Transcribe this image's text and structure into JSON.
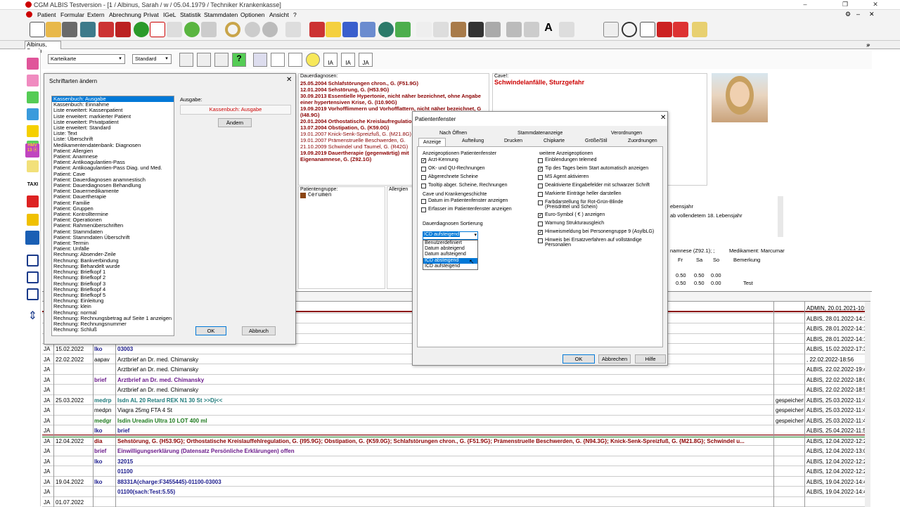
{
  "window": {
    "title": "CGM ALBIS Testversion - [1 / Albinus, Sarah / w / 05.04.1979 / Techniker Krankenkasse]"
  },
  "menu": [
    "Patient",
    "Formular",
    "Extern",
    "Abrechnung",
    "Privat",
    "IGeL",
    "Statistik",
    "Stammdaten",
    "Optionen",
    "Ansicht",
    "?"
  ],
  "tab": {
    "label": "Albinus, Sarah"
  },
  "subtoolbar": {
    "kartei": "Karteikarte",
    "standard": "Standard",
    "ia": "IA",
    "ja": "JA"
  },
  "dauer": {
    "label": "Dauerdiagnosen:",
    "lines": [
      "25.05.2004 Schlafstörungen chron., G. (F51.9G)",
      "12.01.2004 Sehstörung, G. (H53.9G)",
      "30.09.2013 Essentielle Hypertonie, nicht näher bezeichnet, ohne Angabe",
      "einer hypertensiven Krise, G. (I10.90G)",
      "19.09.2019 Vorhofflimmern und Vorhofflattern, nicht näher bezeichnet, G",
      "(I48.9G)",
      "20.01.2004 Orthostatische Kreislaufregulation",
      "13.07.2004 Obstipation, G. (K59.0G)",
      "19.01.2007 Knick-Senk-Spreizfuß, G. (M21.8G)",
      "19.01.2007 Prämenstruelle Beschwerden, G.",
      "21.10.2009 Schwindel und Taumel, G. (R42G)",
      "19.09.2019 Dauertherapie (gegenwärtig) mit",
      "Eigenanamnese, G. (Z92.1G)"
    ]
  },
  "cave": {
    "label": "Cave!:",
    "text": "Schwindelanfälle, Sturzgefahr"
  },
  "patgrp": {
    "label": "Patientengruppe:",
    "value": "Cerumen",
    "allergien": "Allergien"
  },
  "rightinfo": {
    "l1": "ebensjahr",
    "l2": "ab vollendetem 18. Lebensjahr",
    "l3": "namnese (Z92.1); ;",
    "l4": "Medikament: Marcumar",
    "fr": "Fr",
    "sa": "Sa",
    "so": "So",
    "bem": "Bemerkung",
    "r1": [
      "0.50",
      "0.50",
      "0.00"
    ],
    "r2": [
      "0.50",
      "0.50",
      "0.00",
      "Test"
    ]
  },
  "schrift": {
    "title": "Schriftarten ändern",
    "ausgabe_label": "Ausgabe:",
    "ausgabe_value": "Kassenbuch: Ausgabe",
    "aendern": "Ändern",
    "ok": "OK",
    "abbruch": "Abbruch",
    "items": [
      "Kassenbuch: Ausgabe",
      "Kassenbuch: Einnahme",
      "Liste erweitert: Kassenpatient",
      "Liste erweitert: markierter Patient",
      "Liste erweitert: Privatpatient",
      "Liste erweitert: Standard",
      "Liste: Text",
      "Liste: Überschrift",
      "Medikamentendatenbank: Diagnosen",
      "Patient: Allergien",
      "Patient: Anamnese",
      "Patient: Antikoagulantien-Pass",
      "Patient: Antikoagulantien-Pass Diag. und Med.",
      "Patient: Cave",
      "Patient: Dauerdiagnosen anamnestisch",
      "Patient: Dauerdiagnosen Behandlung",
      "Patient: Dauermedikamente",
      "Patient: Dauertherapie",
      "Patient: Familie",
      "Patient: Gruppen",
      "Patient: Kontrolltermine",
      "Patient: Operationen",
      "Patient: Rahmenüberschriften",
      "Patient: Stammdaten",
      "Patient: Stammdaten Überschrift",
      "Patient: Termin",
      "Patient: Unfälle",
      "Rechnung: Absender-Zeile",
      "Rechnung: Bankverbindung",
      "Rechnung: Behandelt wurde",
      "Rechnung: Briefkopf 1",
      "Rechnung: Briefkopf 2",
      "Rechnung: Briefkopf 3",
      "Rechnung: Briefkopf 4",
      "Rechnung: Briefkopf 5",
      "Rechnung: Einleitung",
      "Rechnung: klein",
      "Rechnung: normal",
      "Rechnung: Rechnungsbetrag auf Seite 1 anzeigen",
      "Rechnung: Rechnungsnummer",
      "Rechnung: Schluß"
    ]
  },
  "pf": {
    "title": "Patientenfenster",
    "tabs_row1": [
      "Nach Öffnen",
      "Stammdatenanzeige",
      "Verordnungen"
    ],
    "tabs_row2": [
      "Anzeige",
      "Aufteilung",
      "Drucken",
      "Chipkarte",
      "Größe/Stil",
      "Zuordnungen"
    ],
    "grp1": "Anzeigeoptionen Patientenfenster",
    "g1": [
      {
        "t": "Arzt-Kennung",
        "c": true
      },
      {
        "t": "OK- und QU-Rechnungen",
        "c": false
      },
      {
        "t": "Abgerechnete Scheine",
        "c": false
      },
      {
        "t": "Tooltip abger. Scheine, Rechnungen",
        "c": false
      }
    ],
    "grp2": "Cave und Krankengeschichte",
    "g2": [
      {
        "t": "Datum im Patientenfenster anzeigen",
        "c": false
      },
      {
        "t": "Erfasser im Patientenfenster anzeigen",
        "c": false
      }
    ],
    "grp3": "Dauerdiagnosen Sortierung",
    "sort_value": "ICD aufsteigend",
    "sort_options": [
      "Benutzerdefiniert",
      "Datum absteigend",
      "Datum aufsteigend",
      "ICD absteigend",
      "ICD aufsteigend"
    ],
    "grp4": "weitere Anzeigeoptionen",
    "g4": [
      {
        "t": "Einblendungen telemed",
        "c": false
      },
      {
        "t": "Tip des Tages beim Start automatisch anzeigen",
        "c": true
      },
      {
        "t": "MS Agent aktivieren",
        "c": false
      },
      {
        "t": "Deaktivierte Eingabefelder mit schwarzer Schrift",
        "c": false
      },
      {
        "t": "Markierte Einträge heller darstellen",
        "c": false
      },
      {
        "t": "Farbdarstellung für Rot-Grün-Blinde",
        "c": false,
        "t2": "(Preisdrittel und Schein)"
      },
      {
        "t": "Euro-Symbol ( € ) anzeigen",
        "c": true
      },
      {
        "t": "Warnung Strukturausgleich",
        "c": false
      },
      {
        "t": "Hinweismeldung bei Personengruppe 9 (AsylbLG)",
        "c": true
      },
      {
        "t": "Hinweis bei Ersatzverfahren auf vollständige",
        "c": false,
        "t2": "Personalien"
      }
    ],
    "ok": "OK",
    "abbrechen": "Abbrechen",
    "hilfe": "Hilfe"
  },
  "journal": [
    {
      "a": "",
      "d": "",
      "k": "",
      "t": "",
      "r": "",
      "u": "ADMIN, 20.01.2021-10:15"
    },
    {
      "a": "",
      "d": "",
      "k": "",
      "t": "",
      "r": "",
      "u": "ALBIS, 28.01.2022-14:11"
    },
    {
      "a": "",
      "d": "",
      "k": "",
      "t": "Komplikationen, nicht als entgleist bezei",
      "r": "",
      "u": "ALBIS, 28.01.2022-14:11"
    },
    {
      "a": "",
      "d": "",
      "k": "",
      "t": "",
      "r": "",
      "u": "ALBIS, 28.01.2022-14:11"
    },
    {
      "a": "JA",
      "d": "15.02.2022",
      "k": "lko",
      "t": "03003",
      "r": "",
      "u": "ALBIS, 15.02.2022-17:30"
    },
    {
      "a": "JA",
      "d": "22.02.2022",
      "k": "aapav",
      "t": "Arztbrief an Dr. med. Chimansky",
      "r": "",
      ". 22.02.2022-18:56": "",
      "u": ", 22.02.2022-18:56"
    },
    {
      "a": "JA",
      "d": "",
      "k": "",
      "t": "Arztbrief an Dr. med. Chimansky",
      "r": "",
      "u": "ALBIS, 22.02.2022-19:41"
    },
    {
      "a": "JA",
      "d": "",
      "k": "brief",
      "t": "Arztbrief an Dr. med. Chimansky",
      "r": "",
      "u": "ALBIS, 22.02.2022-18:05"
    },
    {
      "a": "JA",
      "d": "",
      "k": "",
      "t": "Arztbrief an Dr. med. Chimansky",
      "r": "",
      "u": "ALBIS, 22.02.2022-18:56"
    },
    {
      "a": "JA",
      "d": "25.03.2022",
      "k": "medrp",
      "t": "Isdn AL 20 Retard REK N1 30 St >>Dj<<",
      "r": "gespeichert",
      "u": "ALBIS, 25.03.2022-11:49"
    },
    {
      "a": "JA",
      "d": "",
      "k": "medpn",
      "t": "Viagra 25mg FTA 4 St",
      "r": "gespeichert",
      "u": "ALBIS, 25.03.2022-11:49"
    },
    {
      "a": "JA",
      "d": "",
      "k": "medgr",
      "t": "Isdin Ureadin Ultra 10 LOT 400 ml",
      "r": "gespeichert",
      "u": "ALBIS, 25.03.2022-11:49"
    },
    {
      "a": "JA",
      "d": "",
      "k": "lko",
      "t": "brief",
      "r": "",
      "u": "ALBIS, 25.04.2022-11:50"
    },
    {
      "a": "JA",
      "d": "12.04.2022",
      "k": "dia",
      "t": "Sehstörung, G. {H53.9G}; Orthostatische Kreislauffehlregulation, G. {I95.9G}; Obstipation, G. {K59.0G}; Schlafstörungen chron., G. {F51.9G}; Prämenstruelle Beschwerden, G. {N94.3G}; Knick-Senk-Spreizfuß, G. {M21.8G}; Schwindel u...",
      "r": "",
      "u": "ALBIS, 12.04.2022-12:26"
    },
    {
      "a": "JA",
      "d": "",
      "k": "brief",
      "t": "Einwilligungserklärung (Datensatz Persönliche Erklärungen) offen",
      "r": "",
      "u": "ALBIS, 12.04.2022-13:04"
    },
    {
      "a": "JA",
      "d": "",
      "k": "lko",
      "t": "32015",
      "r": "",
      "u": "ALBIS, 12.04.2022-12:26"
    },
    {
      "a": "JA",
      "d": "",
      "k": "",
      "t": "01100",
      "r": "",
      "u": "ALBIS, 12.04.2022-12:26"
    },
    {
      "a": "JA",
      "d": "19.04.2022",
      "k": "lko",
      "t": "88331A(charge:F3455445)-01100-03003",
      "r": "",
      "u": "ALBIS, 19.04.2022-14:41"
    },
    {
      "a": "JA",
      "d": "",
      "k": "",
      "t": "01100(sach:Test:5.55)",
      "r": "",
      "u": "ALBIS, 19.04.2022-14:46"
    },
    {
      "a": "JA",
      "d": "01.07.2022",
      "k": "",
      "t": "",
      "r": "",
      "u": ""
    }
  ],
  "colors": {
    "darkred": "#8b0000",
    "blue": "#1a1a8c",
    "green": "#1e7a1e",
    "selblue": "#0078d7"
  }
}
